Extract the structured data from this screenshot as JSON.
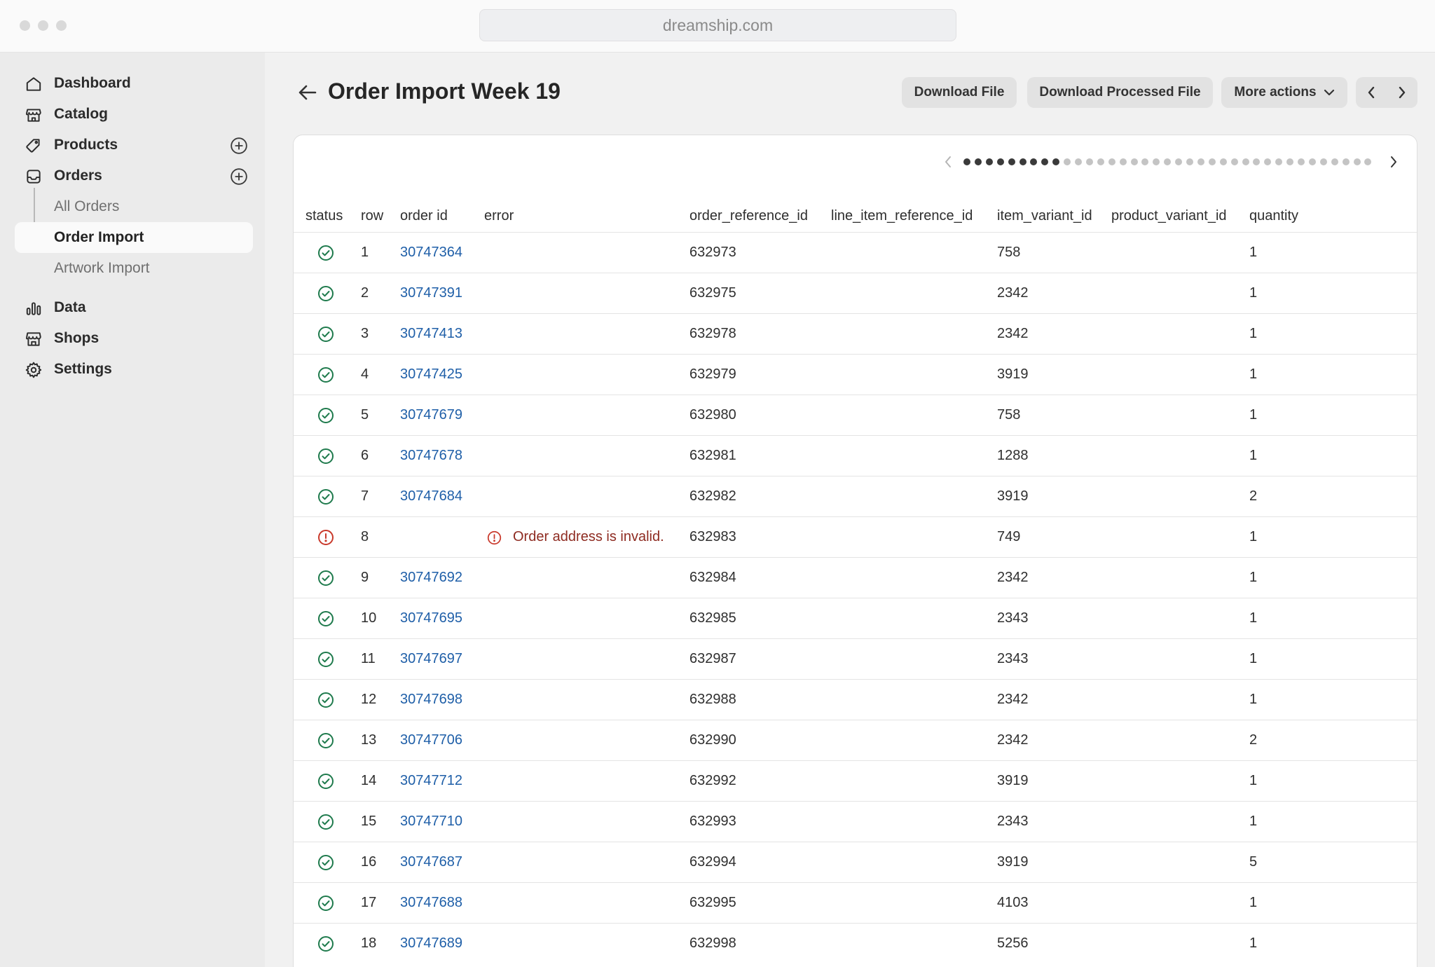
{
  "browser": {
    "url": "dreamship.com"
  },
  "sidebar": {
    "items": [
      {
        "label": "Dashboard",
        "icon": "home-icon"
      },
      {
        "label": "Catalog",
        "icon": "storefront-icon"
      },
      {
        "label": "Products",
        "icon": "tag-icon",
        "add": true
      },
      {
        "label": "Orders",
        "icon": "inbox-icon",
        "add": true
      },
      {
        "label": "Data",
        "icon": "bar-chart-icon"
      },
      {
        "label": "Shops",
        "icon": "shop-icon"
      },
      {
        "label": "Settings",
        "icon": "gear-icon"
      }
    ],
    "sub_items": [
      {
        "label": "All Orders"
      },
      {
        "label": "Order Import",
        "active": true
      },
      {
        "label": "Artwork Import"
      }
    ]
  },
  "header": {
    "title": "Order Import Week 19",
    "buttons": {
      "download": "Download File",
      "download_processed": "Download Processed File",
      "more_actions": "More actions"
    }
  },
  "pager": {
    "total_pages": 37,
    "current_page": 9
  },
  "colors": {
    "success": "#1e7a4c",
    "error": "#c9392b",
    "link": "#1f5fa8"
  },
  "table": {
    "columns": [
      "status",
      "row",
      "order id",
      "error",
      "order_reference_id",
      "line_item_reference_id",
      "item_variant_id",
      "product_variant_id",
      "quantity"
    ],
    "rows": [
      {
        "status": "success",
        "row": "1",
        "order_id": "30747364",
        "error": "",
        "order_reference_id": "632973",
        "line_item_reference_id": "",
        "item_variant_id": "758",
        "product_variant_id": "",
        "quantity": "1"
      },
      {
        "status": "success",
        "row": "2",
        "order_id": "30747391",
        "error": "",
        "order_reference_id": "632975",
        "line_item_reference_id": "",
        "item_variant_id": "2342",
        "product_variant_id": "",
        "quantity": "1"
      },
      {
        "status": "success",
        "row": "3",
        "order_id": "30747413",
        "error": "",
        "order_reference_id": "632978",
        "line_item_reference_id": "",
        "item_variant_id": "2342",
        "product_variant_id": "",
        "quantity": "1"
      },
      {
        "status": "success",
        "row": "4",
        "order_id": "30747425",
        "error": "",
        "order_reference_id": "632979",
        "line_item_reference_id": "",
        "item_variant_id": "3919",
        "product_variant_id": "",
        "quantity": "1"
      },
      {
        "status": "success",
        "row": "5",
        "order_id": "30747679",
        "error": "",
        "order_reference_id": "632980",
        "line_item_reference_id": "",
        "item_variant_id": "758",
        "product_variant_id": "",
        "quantity": "1"
      },
      {
        "status": "success",
        "row": "6",
        "order_id": "30747678",
        "error": "",
        "order_reference_id": "632981",
        "line_item_reference_id": "",
        "item_variant_id": "1288",
        "product_variant_id": "",
        "quantity": "1"
      },
      {
        "status": "success",
        "row": "7",
        "order_id": "30747684",
        "error": "",
        "order_reference_id": "632982",
        "line_item_reference_id": "",
        "item_variant_id": "3919",
        "product_variant_id": "",
        "quantity": "2"
      },
      {
        "status": "error",
        "row": "8",
        "order_id": "",
        "error": "Order address is invalid.",
        "order_reference_id": "632983",
        "line_item_reference_id": "",
        "item_variant_id": "749",
        "product_variant_id": "",
        "quantity": "1"
      },
      {
        "status": "success",
        "row": "9",
        "order_id": "30747692",
        "error": "",
        "order_reference_id": "632984",
        "line_item_reference_id": "",
        "item_variant_id": "2342",
        "product_variant_id": "",
        "quantity": "1"
      },
      {
        "status": "success",
        "row": "10",
        "order_id": "30747695",
        "error": "",
        "order_reference_id": "632985",
        "line_item_reference_id": "",
        "item_variant_id": "2343",
        "product_variant_id": "",
        "quantity": "1"
      },
      {
        "status": "success",
        "row": "11",
        "order_id": "30747697",
        "error": "",
        "order_reference_id": "632987",
        "line_item_reference_id": "",
        "item_variant_id": "2343",
        "product_variant_id": "",
        "quantity": "1"
      },
      {
        "status": "success",
        "row": "12",
        "order_id": "30747698",
        "error": "",
        "order_reference_id": "632988",
        "line_item_reference_id": "",
        "item_variant_id": "2342",
        "product_variant_id": "",
        "quantity": "1"
      },
      {
        "status": "success",
        "row": "13",
        "order_id": "30747706",
        "error": "",
        "order_reference_id": "632990",
        "line_item_reference_id": "",
        "item_variant_id": "2342",
        "product_variant_id": "",
        "quantity": "2"
      },
      {
        "status": "success",
        "row": "14",
        "order_id": "30747712",
        "error": "",
        "order_reference_id": "632992",
        "line_item_reference_id": "",
        "item_variant_id": "3919",
        "product_variant_id": "",
        "quantity": "1"
      },
      {
        "status": "success",
        "row": "15",
        "order_id": "30747710",
        "error": "",
        "order_reference_id": "632993",
        "line_item_reference_id": "",
        "item_variant_id": "2343",
        "product_variant_id": "",
        "quantity": "1"
      },
      {
        "status": "success",
        "row": "16",
        "order_id": "30747687",
        "error": "",
        "order_reference_id": "632994",
        "line_item_reference_id": "",
        "item_variant_id": "3919",
        "product_variant_id": "",
        "quantity": "5"
      },
      {
        "status": "success",
        "row": "17",
        "order_id": "30747688",
        "error": "",
        "order_reference_id": "632995",
        "line_item_reference_id": "",
        "item_variant_id": "4103",
        "product_variant_id": "",
        "quantity": "1"
      },
      {
        "status": "success",
        "row": "18",
        "order_id": "30747689",
        "error": "",
        "order_reference_id": "632998",
        "line_item_reference_id": "",
        "item_variant_id": "5256",
        "product_variant_id": "",
        "quantity": "1"
      }
    ]
  }
}
